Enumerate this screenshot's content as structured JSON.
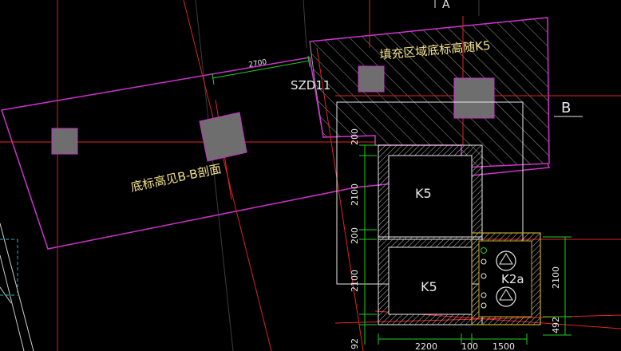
{
  "drawing": {
    "background": "#000000",
    "labels": {
      "fill_note": "填充区域底标高随K5",
      "section_note": "底标高见B-B剖面",
      "column_tag": "SZD11",
      "section_marker": "B",
      "grid_marker": "A",
      "pit_upper": "K5",
      "pit_lower": "K5",
      "pit_small": "K2a"
    },
    "dimensions": {
      "top_span": "2700",
      "left_upper": "200",
      "left_mid": "2100",
      "left_gap": "200",
      "left_lower": "2100",
      "left_bottom": "92",
      "right_span": "2100",
      "right_bottom": "492",
      "bottom_a": "2200",
      "bottom_b": "100",
      "bottom_c": "1500"
    },
    "colors": {
      "slab_outline": "#cc33cc",
      "axis": "#e02424",
      "hatch": "#9a9a9a",
      "column_fill": "#6e6e6e",
      "dimension": "#22cc22",
      "label_yellow": "#f2e08a",
      "white_line": "#e8e8e8",
      "pit_wall": "#9a9a9a",
      "small_pit": "#c8a820",
      "cyan": "#22b8c8"
    }
  }
}
